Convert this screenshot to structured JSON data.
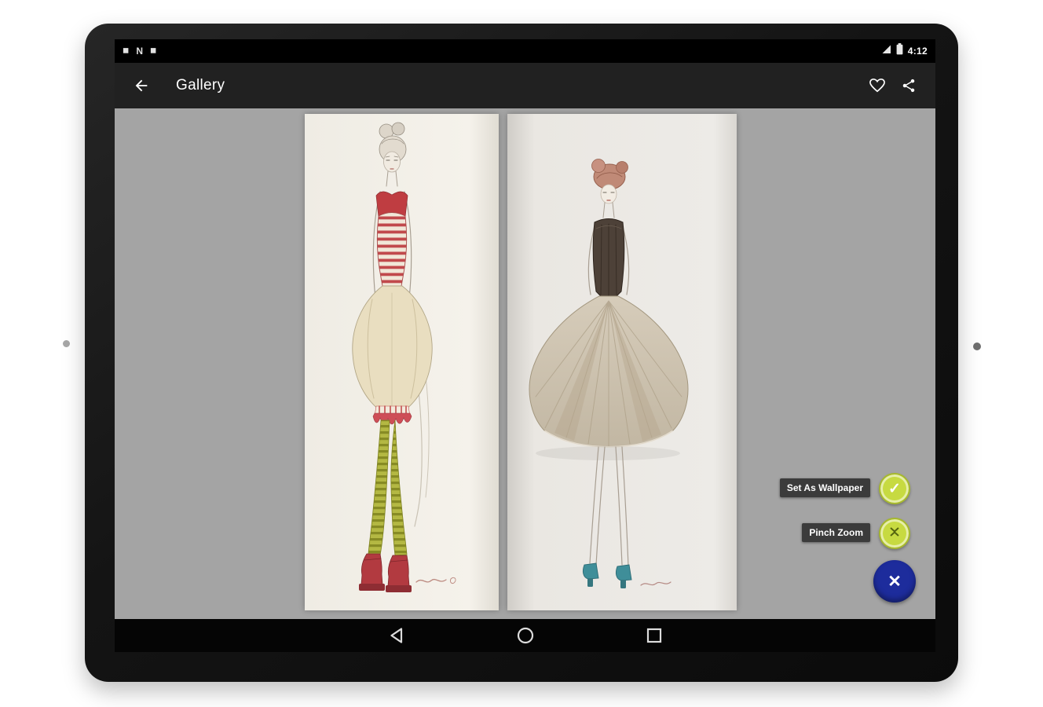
{
  "status_bar": {
    "time": "4:12",
    "left_icons": [
      {
        "name": "notification-square-icon-1",
        "glyph": "◼"
      },
      {
        "name": "nfc-n-icon",
        "glyph": "N"
      },
      {
        "name": "notification-square-icon-2",
        "glyph": "◼"
      }
    ],
    "right_icons": [
      {
        "name": "signal-icon"
      },
      {
        "name": "battery-icon"
      }
    ]
  },
  "app_bar": {
    "title": "Gallery",
    "icons": [
      {
        "name": "back-arrow-icon"
      },
      {
        "name": "favorite-heart-icon"
      },
      {
        "name": "share-icon"
      }
    ]
  },
  "gallery": {
    "images": [
      {
        "name": "fashion-sketch-striped-dress",
        "description": "watercolor fashion sketch, red striped corset dress with olive striped stockings and red platform heels"
      },
      {
        "name": "fashion-sketch-corset-gown",
        "description": "watercolor fashion sketch, dark corset with full taupe skirt and teal shoes"
      }
    ]
  },
  "fab_menu": {
    "actions": [
      {
        "label": "Set As Wallpaper",
        "icon": "check-icon",
        "glyph": "✓"
      },
      {
        "label": "Pinch Zoom",
        "icon": "pinch-zoom-icon",
        "glyph": ""
      }
    ],
    "close": {
      "icon": "close-icon",
      "glyph": "✕"
    }
  },
  "nav_bar": {
    "icons": [
      {
        "name": "nav-back-icon"
      },
      {
        "name": "nav-home-icon"
      },
      {
        "name": "nav-recents-icon"
      }
    ]
  },
  "colors": {
    "accent_green": "#c7da41",
    "close_blue": "#1d2c9c",
    "label_bg": "#3b3b3b",
    "app_bar_bg": "#212121",
    "content_bg": "#a4a4a4"
  }
}
